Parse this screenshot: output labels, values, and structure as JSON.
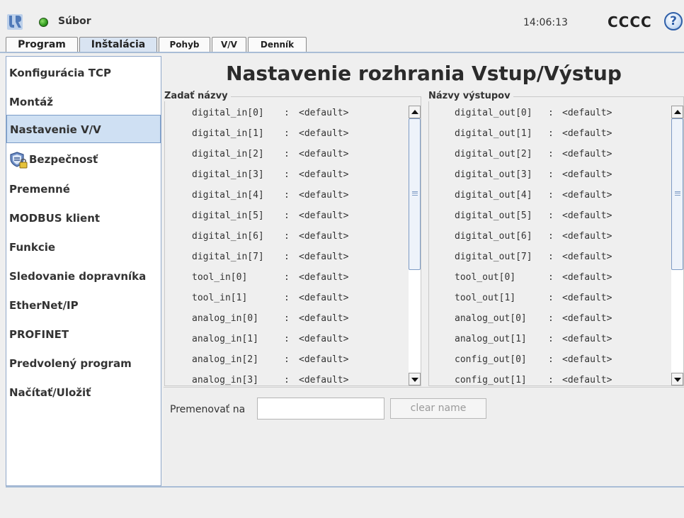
{
  "header": {
    "file_menu": "Súbor",
    "time": "14:06:13",
    "robot_name": "CCCC",
    "help": "?"
  },
  "tabs": [
    {
      "label": "Program",
      "active": false
    },
    {
      "label": "Inštalácia",
      "active": true
    },
    {
      "label": "Pohyb",
      "active": false
    },
    {
      "label": "V/V",
      "active": false
    },
    {
      "label": "Denník",
      "active": false
    }
  ],
  "sidebar": {
    "items": [
      {
        "label": "Konfigurácia TCP"
      },
      {
        "label": "Montáž"
      },
      {
        "label": "Nastavenie V/V",
        "selected": true
      },
      {
        "label": "Bezpečnosť",
        "icon": "safety-shield-lock-icon"
      },
      {
        "label": "Premenné"
      },
      {
        "label": "MODBUS klient"
      },
      {
        "label": "Funkcie"
      },
      {
        "label": "Sledovanie dopravníka"
      },
      {
        "label": "EtherNet/IP"
      },
      {
        "label": "PROFINET"
      },
      {
        "label": "Predvolený program"
      },
      {
        "label": "Načítať/Uložiť"
      }
    ]
  },
  "main": {
    "title": "Nastavenie rozhrania Vstup/Výstup",
    "inputs": {
      "title": "Zadať názvy",
      "separator": ":",
      "rows": [
        {
          "name": "digital_in[0]",
          "value": "<default>"
        },
        {
          "name": "digital_in[1]",
          "value": "<default>"
        },
        {
          "name": "digital_in[2]",
          "value": "<default>"
        },
        {
          "name": "digital_in[3]",
          "value": "<default>"
        },
        {
          "name": "digital_in[4]",
          "value": "<default>"
        },
        {
          "name": "digital_in[5]",
          "value": "<default>"
        },
        {
          "name": "digital_in[6]",
          "value": "<default>"
        },
        {
          "name": "digital_in[7]",
          "value": "<default>"
        },
        {
          "name": "tool_in[0]",
          "value": "<default>"
        },
        {
          "name": "tool_in[1]",
          "value": "<default>"
        },
        {
          "name": "analog_in[0]",
          "value": "<default>"
        },
        {
          "name": "analog_in[1]",
          "value": "<default>"
        },
        {
          "name": "analog_in[2]",
          "value": "<default>"
        },
        {
          "name": "analog_in[3]",
          "value": "<default>"
        }
      ]
    },
    "outputs": {
      "title": "Názvy výstupov",
      "separator": ":",
      "rows": [
        {
          "name": "digital_out[0]",
          "value": "<default>"
        },
        {
          "name": "digital_out[1]",
          "value": "<default>"
        },
        {
          "name": "digital_out[2]",
          "value": "<default>"
        },
        {
          "name": "digital_out[3]",
          "value": "<default>"
        },
        {
          "name": "digital_out[4]",
          "value": "<default>"
        },
        {
          "name": "digital_out[5]",
          "value": "<default>"
        },
        {
          "name": "digital_out[6]",
          "value": "<default>"
        },
        {
          "name": "digital_out[7]",
          "value": "<default>"
        },
        {
          "name": "tool_out[0]",
          "value": "<default>"
        },
        {
          "name": "tool_out[1]",
          "value": "<default>"
        },
        {
          "name": "analog_out[0]",
          "value": "<default>"
        },
        {
          "name": "analog_out[1]",
          "value": "<default>"
        },
        {
          "name": "config_out[0]",
          "value": "<default>"
        },
        {
          "name": "config_out[1]",
          "value": "<default>"
        }
      ]
    },
    "rename": {
      "label": "Premenovať na",
      "value": "",
      "clear_button": "clear name"
    }
  },
  "colors": {
    "accent": "#7a9cc8",
    "selected_bg": "#cfe0f3",
    "status_led": "#2f9a1e"
  }
}
